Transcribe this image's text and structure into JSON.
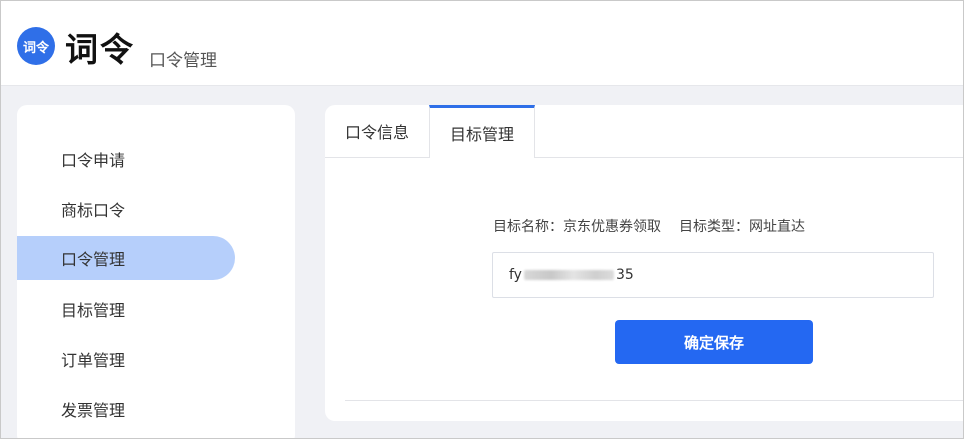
{
  "header": {
    "logo_text": "词令",
    "app_name": "词令",
    "subtitle": "口令管理"
  },
  "sidebar": {
    "items": [
      {
        "label": "口令申请"
      },
      {
        "label": "商标口令"
      },
      {
        "label": "口令管理",
        "active": true
      },
      {
        "label": "目标管理"
      },
      {
        "label": "订单管理"
      },
      {
        "label": "发票管理"
      }
    ]
  },
  "main": {
    "tabs": [
      {
        "label": "口令信息"
      },
      {
        "label": "目标管理",
        "active": true
      }
    ],
    "target_name_label": "目标名称：京东优惠券领取",
    "target_type_label": "目标类型：网址直达",
    "url_input": {
      "prefix": "fy",
      "suffix": "35"
    },
    "save_label": "确定保存"
  },
  "colors": {
    "accent": "#2468f2",
    "active_nav_bg": "#b6cffb",
    "logo_bg": "#2f6fe8"
  }
}
